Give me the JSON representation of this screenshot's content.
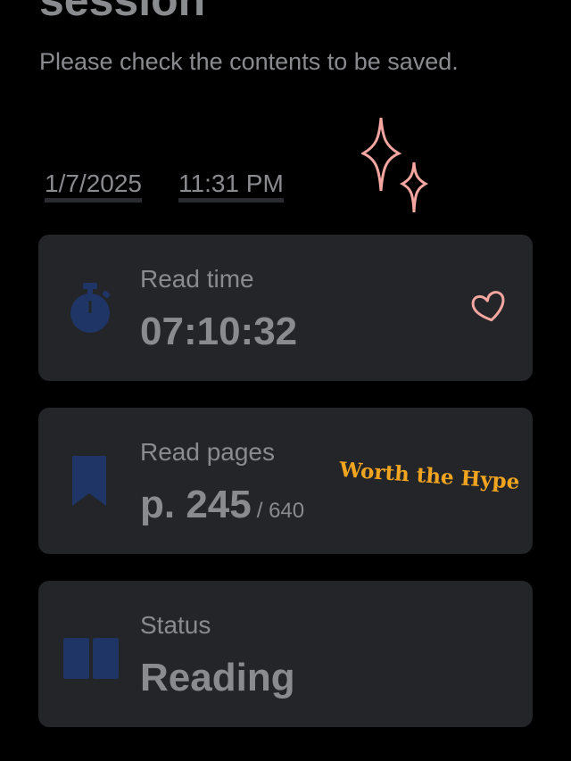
{
  "header": {
    "title": "session",
    "subtitle": "Please check the contents to be saved."
  },
  "timestamp": {
    "date": "1/7/2025",
    "time": "11:31 PM"
  },
  "cards": [
    {
      "icon": "stopwatch-icon",
      "label": "Read time",
      "value": "07:10:32"
    },
    {
      "icon": "bookmark-icon",
      "label": "Read pages",
      "value": "p. 245",
      "total": "/ 640"
    },
    {
      "icon": "book-open-icon",
      "label": "Status",
      "value": "Reading"
    }
  ],
  "stickers": {
    "text": "Worth the Hype"
  },
  "colors": {
    "background": "#000000",
    "card": "#242529",
    "text": "#8a8b8f",
    "icon": "#1f3566",
    "sparkle": "#f4a6a0",
    "sticker": "#f1a41f"
  }
}
